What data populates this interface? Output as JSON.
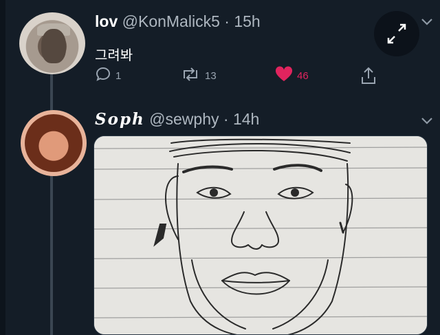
{
  "tweets": [
    {
      "display_name": "lov",
      "handle": "@KonMalick5",
      "separator": "·",
      "time": "15h",
      "text": "그려봐",
      "replies": "1",
      "retweets": "13",
      "likes": "46"
    },
    {
      "display_name": "Soph",
      "handle": "@sewphy",
      "separator": "·",
      "time": "14h"
    }
  ],
  "colors": {
    "background": "#141d27",
    "like_active": "#e0245e",
    "secondary_text": "#aeb7c0"
  },
  "icons": [
    "reply-icon",
    "retweet-icon",
    "heart-icon",
    "share-icon",
    "expand-icon",
    "chevron-down-icon"
  ]
}
